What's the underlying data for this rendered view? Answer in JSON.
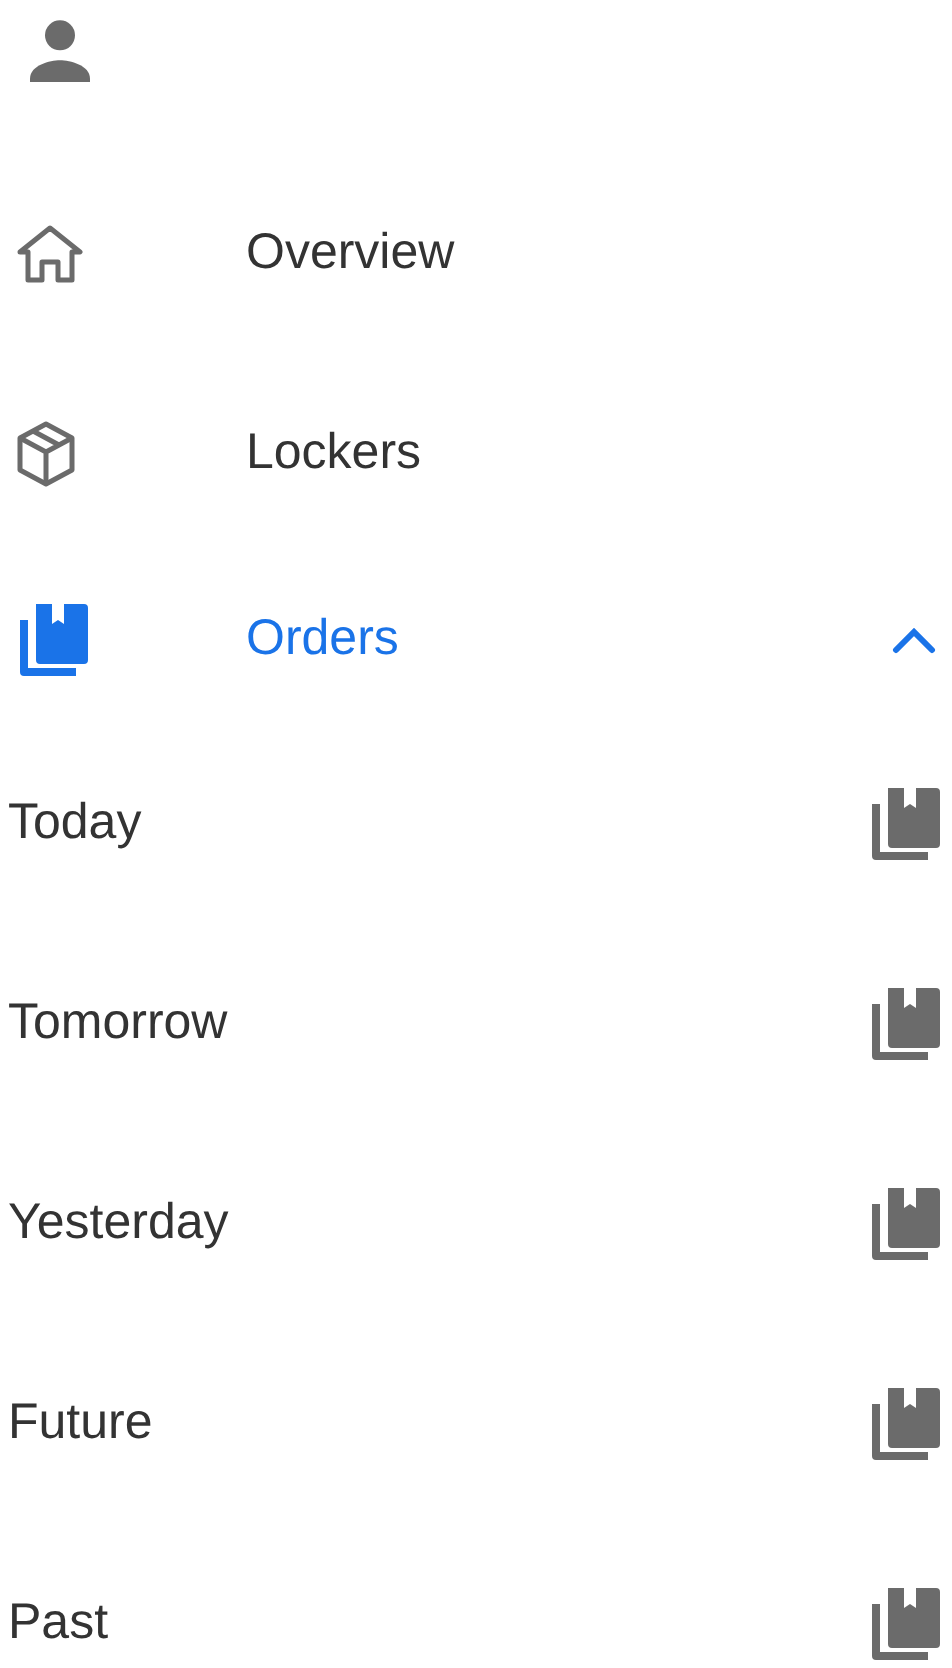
{
  "nav": [
    {
      "label": "Overview",
      "kind": "home",
      "selected": false
    },
    {
      "label": "Lockers",
      "kind": "box",
      "selected": false
    },
    {
      "label": "Orders",
      "kind": "orders",
      "selected": true,
      "expanded": true,
      "children": [
        {
          "label": "Today"
        },
        {
          "label": "Tomorrow"
        },
        {
          "label": "Yesterday"
        },
        {
          "label": "Future"
        },
        {
          "label": "Past"
        }
      ]
    }
  ]
}
